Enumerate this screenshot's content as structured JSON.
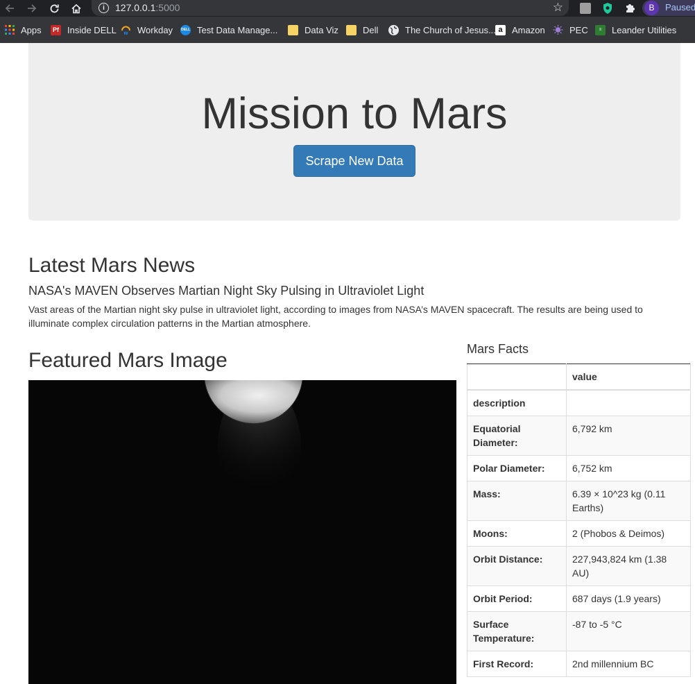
{
  "browser": {
    "url_host": "127.0.0.1",
    "url_port": ":5000",
    "profile_initial": "B",
    "profile_status": "Paused",
    "bookmarks": [
      {
        "label": "Apps",
        "icon": "apps-grid-icon"
      },
      {
        "label": "Inside DELL",
        "icon": "pf-icon"
      },
      {
        "label": "Workday",
        "icon": "workday-icon"
      },
      {
        "label": "Test Data Manage...",
        "icon": "dell-icon"
      },
      {
        "label": "Data Viz",
        "icon": "folder-icon"
      },
      {
        "label": "Dell",
        "icon": "folder-icon"
      },
      {
        "label": "The Church of Jesus...",
        "icon": "globe-icon"
      },
      {
        "label": "Amazon",
        "icon": "amazon-icon"
      },
      {
        "label": "PEC",
        "icon": "pec-icon"
      },
      {
        "label": "Leander Utilities",
        "icon": "leander-icon"
      }
    ]
  },
  "page": {
    "title": "Mission to Mars",
    "scrape_button": "Scrape New Data",
    "news_heading": "Latest Mars News",
    "news_title": "NASA's MAVEN Observes Martian Night Sky Pulsing in Ultraviolet Light",
    "news_teaser": "Vast areas of the Martian night sky pulse in ultraviolet light, according to images from NASA’s MAVEN spacecraft. The results are being used to illuminate complex circulation patterns in the Martian atmosphere.",
    "featured_heading": "Featured Mars Image",
    "facts_heading": "Mars Facts",
    "facts_table": {
      "header": [
        "",
        "value"
      ],
      "index_label": "description",
      "rows": [
        {
          "label": "Equatorial Diameter:",
          "value": "6,792 km"
        },
        {
          "label": "Polar Diameter:",
          "value": "6,752 km"
        },
        {
          "label": "Mass:",
          "value": "6.39 × 10^23 kg (0.11 Earths)"
        },
        {
          "label": "Moons:",
          "value": "2 (Phobos & Deimos)"
        },
        {
          "label": "Orbit Distance:",
          "value": "227,943,824 km (1.38 AU)"
        },
        {
          "label": "Orbit Period:",
          "value": "687 days (1.9 years)"
        },
        {
          "label": "Surface Temperature:",
          "value": "-87 to -5 °C"
        },
        {
          "label": "First Record:",
          "value": "2nd millennium BC"
        }
      ]
    }
  },
  "colors": {
    "button": "#337ab7",
    "jumbotron_bg": "#eeeeee",
    "toolbar": "#202124",
    "bookmark_bar": "#35363a"
  }
}
